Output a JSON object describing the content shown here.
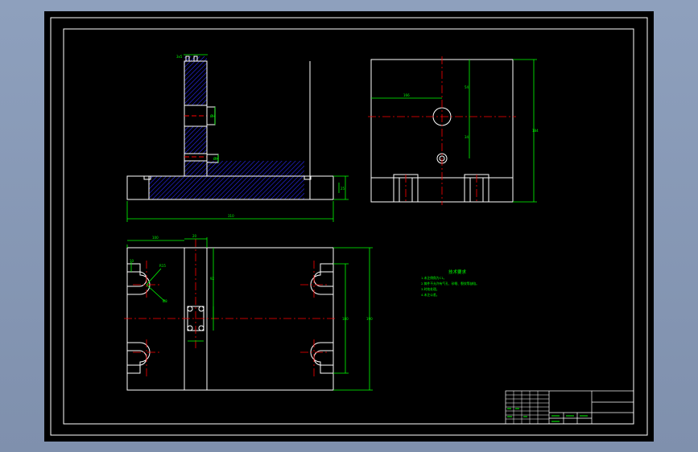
{
  "colors": {
    "background": "#000000",
    "outline": "#ffffff",
    "dimension": "#00ff00",
    "centerline": "#ff0000",
    "hatch": "#0000ff",
    "window_bg": "#8ea0bd"
  },
  "views": {
    "front": {
      "dims": {
        "slot_top": "3x5",
        "slot_mid": "ØH",
        "slot_low": "ØM",
        "base_h": "25",
        "overall_w": "310"
      }
    },
    "side": {
      "dims": {
        "h1": "54",
        "h2": "34",
        "top_w": "166",
        "overall_h": "184"
      }
    },
    "top": {
      "dims": {
        "offset": "100",
        "offset2": "20",
        "radius": "R15",
        "slot_w": "10",
        "inner_h": "92",
        "mid_h": "180",
        "overall_h": "190",
        "hole": "Ø8"
      }
    }
  },
  "tech_notes": {
    "title": "技术要求",
    "lines": [
      "1.未注倒角为C1。",
      "2.铸件不允许有气孔、砂眼、裂纹等缺陷。",
      "3.时效处理。",
      "4.未注公差。"
    ]
  }
}
